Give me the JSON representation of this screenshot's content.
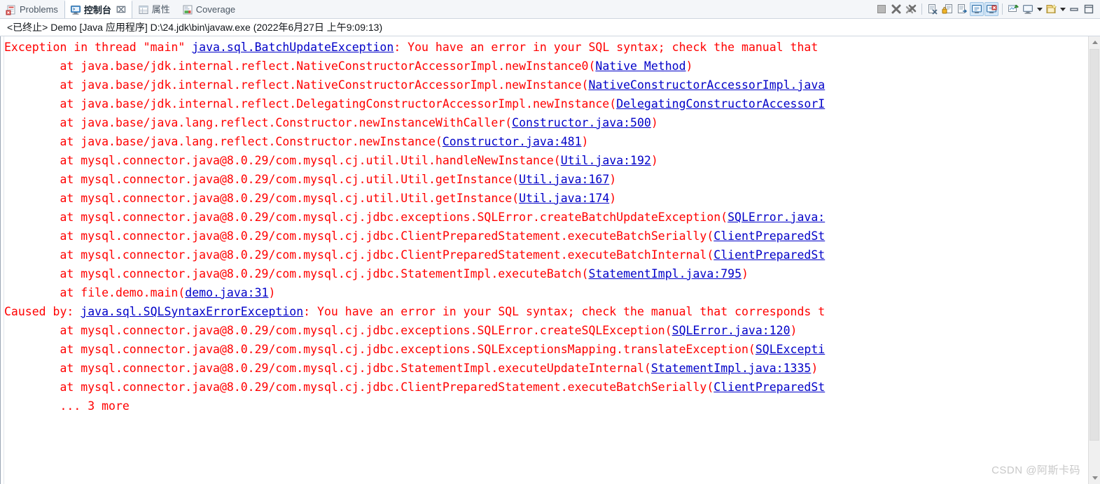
{
  "tabbar": {
    "tabs": [
      {
        "label": "Problems",
        "icon": "problems-icon",
        "active": false,
        "closable": false
      },
      {
        "label": "控制台",
        "icon": "console-icon",
        "active": true,
        "closable": true,
        "close_glyph": "⌧"
      },
      {
        "label": "属性",
        "icon": "properties-icon",
        "active": false,
        "closable": false
      },
      {
        "label": "Coverage",
        "icon": "coverage-icon",
        "active": false,
        "closable": false
      }
    ],
    "toolbar": [
      {
        "name": "terminate-button",
        "icon": "stop-square-icon",
        "pressed": false
      },
      {
        "name": "remove-launch-button",
        "icon": "remove-x-icon",
        "pressed": false
      },
      {
        "name": "remove-all-terminated-button",
        "icon": "remove-all-x-icon",
        "pressed": false
      },
      {
        "name": "separator-1",
        "icon": "separator",
        "pressed": false
      },
      {
        "name": "clear-console-button",
        "icon": "clear-console-icon",
        "pressed": false
      },
      {
        "name": "scroll-lock-button",
        "icon": "lock-icon",
        "pressed": false
      },
      {
        "name": "word-wrap-button",
        "icon": "word-wrap-icon",
        "pressed": false
      },
      {
        "name": "show-console-on-output-button",
        "icon": "show-console-stdout-icon",
        "pressed": true
      },
      {
        "name": "show-console-on-error-button",
        "icon": "show-console-stderr-icon",
        "pressed": true
      },
      {
        "name": "separator-2",
        "icon": "separator",
        "pressed": false
      },
      {
        "name": "pin-console-button",
        "icon": "pin-console-icon",
        "pressed": false
      },
      {
        "name": "display-selected-console-button",
        "icon": "display-console-icon",
        "pressed": false
      },
      {
        "name": "display-selected-console-dropdown",
        "icon": "chevron-down-icon",
        "pressed": false
      },
      {
        "name": "open-console-button",
        "icon": "new-console-icon",
        "pressed": false
      },
      {
        "name": "open-console-dropdown",
        "icon": "chevron-down-icon",
        "pressed": false
      },
      {
        "name": "minimize-button",
        "icon": "minimize-icon",
        "pressed": false
      },
      {
        "name": "maximize-button",
        "icon": "maximize-icon",
        "pressed": false
      }
    ]
  },
  "status": {
    "text": "<已终止> Demo [Java 应用程序] D:\\24.jdk\\bin\\javaw.exe  (2022年6月27日 上午9:09:13)"
  },
  "console": {
    "text_color": "#ff0000",
    "link_color": "#0000c8",
    "lines": [
      [
        {
          "t": "Exception in thread \"main\" ",
          "link": false
        },
        {
          "t": "java.sql.BatchUpdateException",
          "link": true
        },
        {
          "t": ": You have an error in your SQL syntax; check the manual that",
          "link": false
        }
      ],
      [
        {
          "t": "        at java.base/jdk.internal.reflect.NativeConstructorAccessorImpl.newInstance0(",
          "link": false
        },
        {
          "t": "Native Method",
          "link": true
        },
        {
          "t": ")",
          "link": false
        }
      ],
      [
        {
          "t": "        at java.base/jdk.internal.reflect.NativeConstructorAccessorImpl.newInstance(",
          "link": false
        },
        {
          "t": "NativeConstructorAccessorImpl.java",
          "link": true
        }
      ],
      [
        {
          "t": "        at java.base/jdk.internal.reflect.DelegatingConstructorAccessorImpl.newInstance(",
          "link": false
        },
        {
          "t": "DelegatingConstructorAccessorI",
          "link": true
        }
      ],
      [
        {
          "t": "        at java.base/java.lang.reflect.Constructor.newInstanceWithCaller(",
          "link": false
        },
        {
          "t": "Constructor.java:500",
          "link": true
        },
        {
          "t": ")",
          "link": false
        }
      ],
      [
        {
          "t": "        at java.base/java.lang.reflect.Constructor.newInstance(",
          "link": false
        },
        {
          "t": "Constructor.java:481",
          "link": true
        },
        {
          "t": ")",
          "link": false
        }
      ],
      [
        {
          "t": "        at mysql.connector.java@8.0.29/com.mysql.cj.util.Util.handleNewInstance(",
          "link": false
        },
        {
          "t": "Util.java:192",
          "link": true
        },
        {
          "t": ")",
          "link": false
        }
      ],
      [
        {
          "t": "        at mysql.connector.java@8.0.29/com.mysql.cj.util.Util.getInstance(",
          "link": false
        },
        {
          "t": "Util.java:167",
          "link": true
        },
        {
          "t": ")",
          "link": false
        }
      ],
      [
        {
          "t": "        at mysql.connector.java@8.0.29/com.mysql.cj.util.Util.getInstance(",
          "link": false
        },
        {
          "t": "Util.java:174",
          "link": true
        },
        {
          "t": ")",
          "link": false
        }
      ],
      [
        {
          "t": "        at mysql.connector.java@8.0.29/com.mysql.cj.jdbc.exceptions.SQLError.createBatchUpdateException(",
          "link": false
        },
        {
          "t": "SQLError.java:",
          "link": true
        }
      ],
      [
        {
          "t": "        at mysql.connector.java@8.0.29/com.mysql.cj.jdbc.ClientPreparedStatement.executeBatchSerially(",
          "link": false
        },
        {
          "t": "ClientPreparedSt",
          "link": true
        }
      ],
      [
        {
          "t": "        at mysql.connector.java@8.0.29/com.mysql.cj.jdbc.ClientPreparedStatement.executeBatchInternal(",
          "link": false
        },
        {
          "t": "ClientPreparedSt",
          "link": true
        }
      ],
      [
        {
          "t": "        at mysql.connector.java@8.0.29/com.mysql.cj.jdbc.StatementImpl.executeBatch(",
          "link": false
        },
        {
          "t": "StatementImpl.java:795",
          "link": true
        },
        {
          "t": ")",
          "link": false
        }
      ],
      [
        {
          "t": "        at file.demo.main(",
          "link": false
        },
        {
          "t": "demo.java:31",
          "link": true
        },
        {
          "t": ")",
          "link": false
        }
      ],
      [
        {
          "t": "Caused by: ",
          "link": false
        },
        {
          "t": "java.sql.SQLSyntaxErrorException",
          "link": true
        },
        {
          "t": ": You have an error in your SQL syntax; check the manual that corresponds t",
          "link": false
        }
      ],
      [
        {
          "t": "        at mysql.connector.java@8.0.29/com.mysql.cj.jdbc.exceptions.SQLError.createSQLException(",
          "link": false
        },
        {
          "t": "SQLError.java:120",
          "link": true
        },
        {
          "t": ")",
          "link": false
        }
      ],
      [
        {
          "t": "        at mysql.connector.java@8.0.29/com.mysql.cj.jdbc.exceptions.SQLExceptionsMapping.translateException(",
          "link": false
        },
        {
          "t": "SQLExcepti",
          "link": true
        }
      ],
      [
        {
          "t": "        at mysql.connector.java@8.0.29/com.mysql.cj.jdbc.StatementImpl.executeUpdateInternal(",
          "link": false
        },
        {
          "t": "StatementImpl.java:1335",
          "link": true
        },
        {
          "t": ")",
          "link": false
        }
      ],
      [
        {
          "t": "        at mysql.connector.java@8.0.29/com.mysql.cj.jdbc.ClientPreparedStatement.executeBatchSerially(",
          "link": false
        },
        {
          "t": "ClientPreparedSt",
          "link": true
        }
      ],
      [
        {
          "t": "        ... 3 more",
          "link": false
        }
      ]
    ]
  },
  "watermark": {
    "text": "CSDN @阿斯卡码"
  }
}
